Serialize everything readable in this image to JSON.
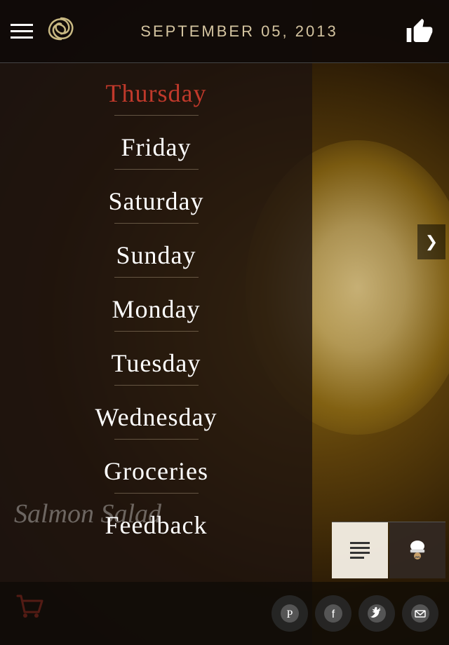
{
  "header": {
    "title": "SEPTEMBER 05, 2013",
    "thumbs_label": "👍"
  },
  "nav": {
    "items": [
      {
        "label": "Thursday",
        "active": true
      },
      {
        "label": "Friday",
        "active": false
      },
      {
        "label": "Saturday",
        "active": false
      },
      {
        "label": "Sunday",
        "active": false
      },
      {
        "label": "Monday",
        "active": false
      },
      {
        "label": "Tuesday",
        "active": false
      },
      {
        "label": "Wednesday",
        "active": false
      },
      {
        "label": "Groceries",
        "active": false
      },
      {
        "label": "Feedback",
        "active": false
      }
    ]
  },
  "featured_dish": "Salmon Salad",
  "carousel": {
    "arrow_label": "❯"
  },
  "bottom_actions": {
    "pinterest": "P",
    "facebook": "f",
    "twitter": "t",
    "email": "✉"
  },
  "action_squares": {
    "menu_icon": "≡",
    "chef_icon": "👨‍🍳"
  },
  "colors": {
    "active_day": "#c0392b",
    "text_white": "#ffffff",
    "header_bg": "rgba(15,10,8,0.9)"
  }
}
